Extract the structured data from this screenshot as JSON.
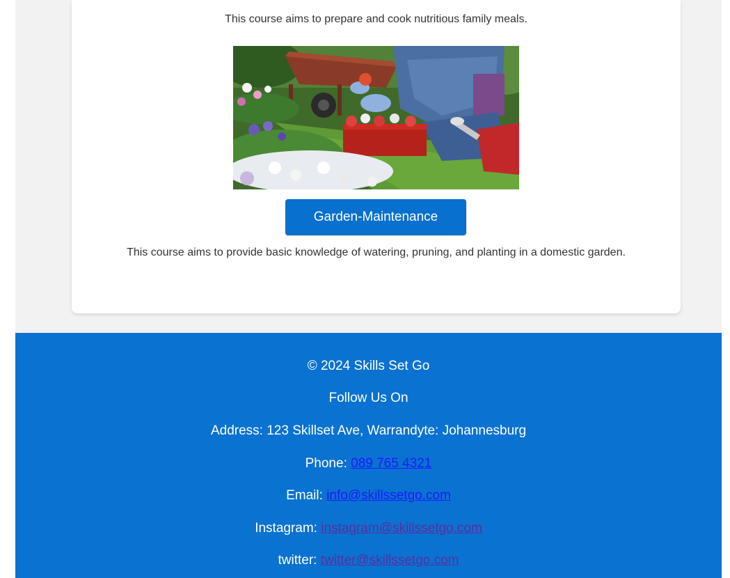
{
  "courses": {
    "cooking": {
      "description": "This course aims to prepare and cook nutritious family meals."
    },
    "garden": {
      "button_label": "Garden-Maintenance",
      "description": "This course aims to provide basic knowledge of watering, pruning, and planting in a domestic garden."
    }
  },
  "footer": {
    "copyright": "© 2024 Skills Set Go",
    "follow": "Follow Us On",
    "address": "Address: 123 Skillset Ave, Warrandyte: Johannesburg",
    "phone_label": "Phone: ",
    "phone_value": "089 765 4321",
    "email_label": "Email: ",
    "email_value": "info@skillssetgo.com",
    "instagram_label": "Instagram: ",
    "instagram_value": "instagram@skillssetgo.com",
    "twitter_label": "twitter: ",
    "twitter_value": "twitter@skillssetgo.com"
  },
  "colors": {
    "footer_bg": "#0a72d1",
    "button_bg": "#0870cf",
    "link_unvisited": "#1a1aff",
    "link_visited": "#5a2e9e"
  }
}
